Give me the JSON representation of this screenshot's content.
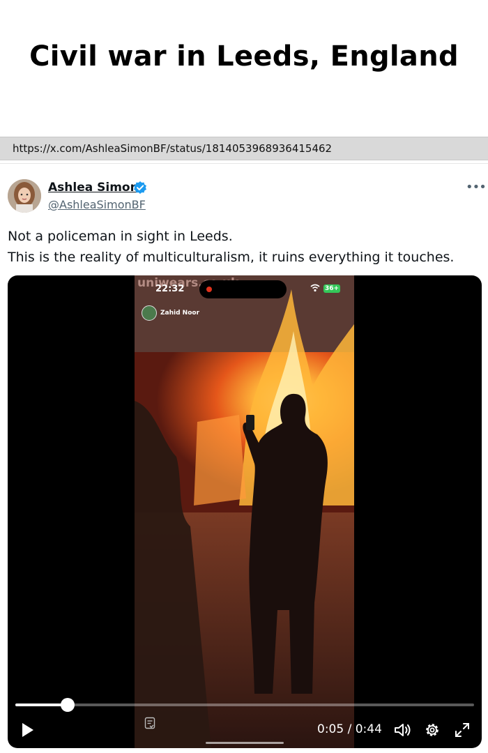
{
  "headline": "Civil war in Leeds, England",
  "url": "https://x.com/AshleaSimonBF/status/1814053968936415462",
  "tweet": {
    "author_name": "Ashlea Simon",
    "handle": "@AshleaSimonBF",
    "verified": true,
    "text_lines": [
      "Not a policeman in sight in Leeds.",
      "This is the reality of multiculturalism, it ruins everything it touches."
    ]
  },
  "video": {
    "phone_time": "22:32",
    "battery": "36+",
    "live_user_name": "Zahid Noor",
    "storefront_sign": "uniwears.co.uk",
    "progress": 0.114,
    "current_time": "0:05",
    "separator": " / ",
    "duration": "0:44"
  },
  "icons": {
    "more": "more-horizontal-icon",
    "verified": "verified-badge-icon",
    "play": "play-icon",
    "captions": "captions-icon",
    "volume": "volume-icon",
    "settings": "settings-gear-icon",
    "fullscreen": "fullscreen-icon"
  },
  "colors": {
    "verified_blue": "#1d9bf0",
    "fire_orange": "#ff7a1a",
    "url_bar_bg": "#d9d9d9"
  }
}
